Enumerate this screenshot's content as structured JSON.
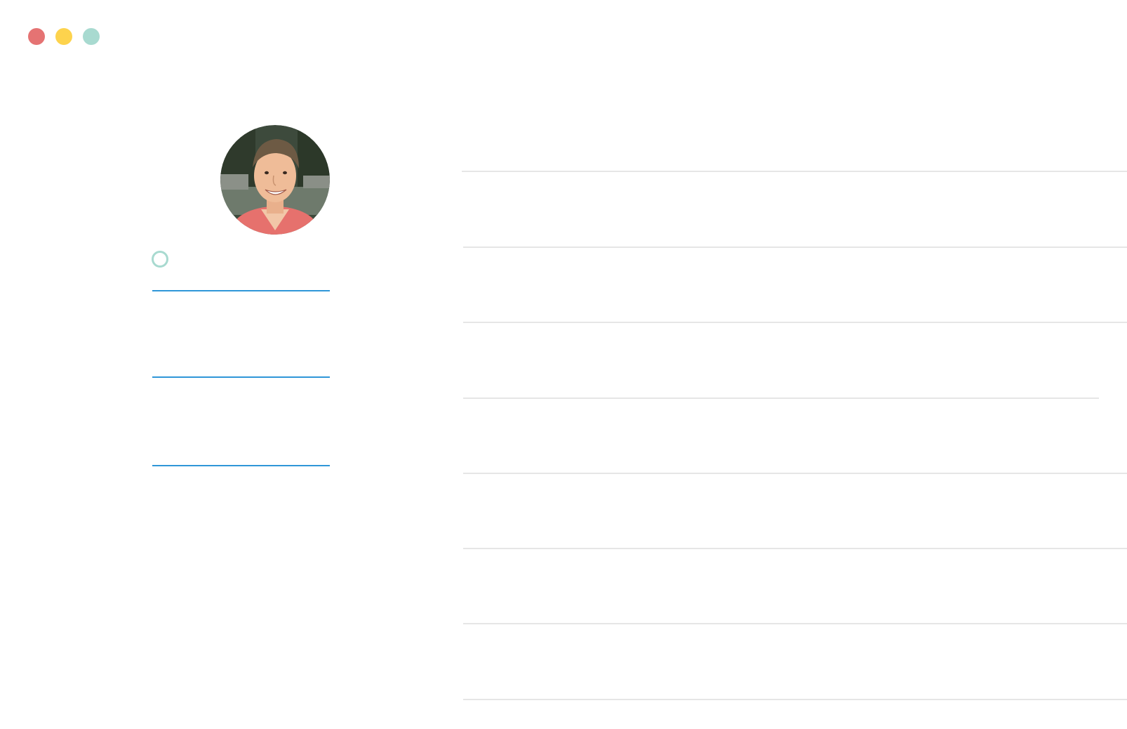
{
  "window_controls": {
    "close": {
      "icon": "close-dot",
      "color": "#e57373"
    },
    "minimize": {
      "icon": "minimize-dot",
      "color": "#fdd34d"
    },
    "maximize": {
      "icon": "maximize-dot",
      "color": "#a8dad0"
    }
  },
  "profile": {
    "avatar": {
      "icon": "user-photo"
    },
    "status_indicator": {
      "icon": "circle-outline-icon",
      "color": "#a8dad0"
    },
    "fields": [
      {
        "value": "",
        "line_color": "#2f96d8"
      },
      {
        "value": "",
        "line_color": "#2f96d8"
      },
      {
        "value": "",
        "line_color": "#2f96d8"
      }
    ]
  },
  "list": {
    "rows": [
      {
        "text": ""
      },
      {
        "text": ""
      },
      {
        "text": ""
      },
      {
        "text": ""
      },
      {
        "text": ""
      },
      {
        "text": ""
      },
      {
        "text": ""
      },
      {
        "text": ""
      }
    ],
    "divider_color": "#e6e6e6"
  }
}
